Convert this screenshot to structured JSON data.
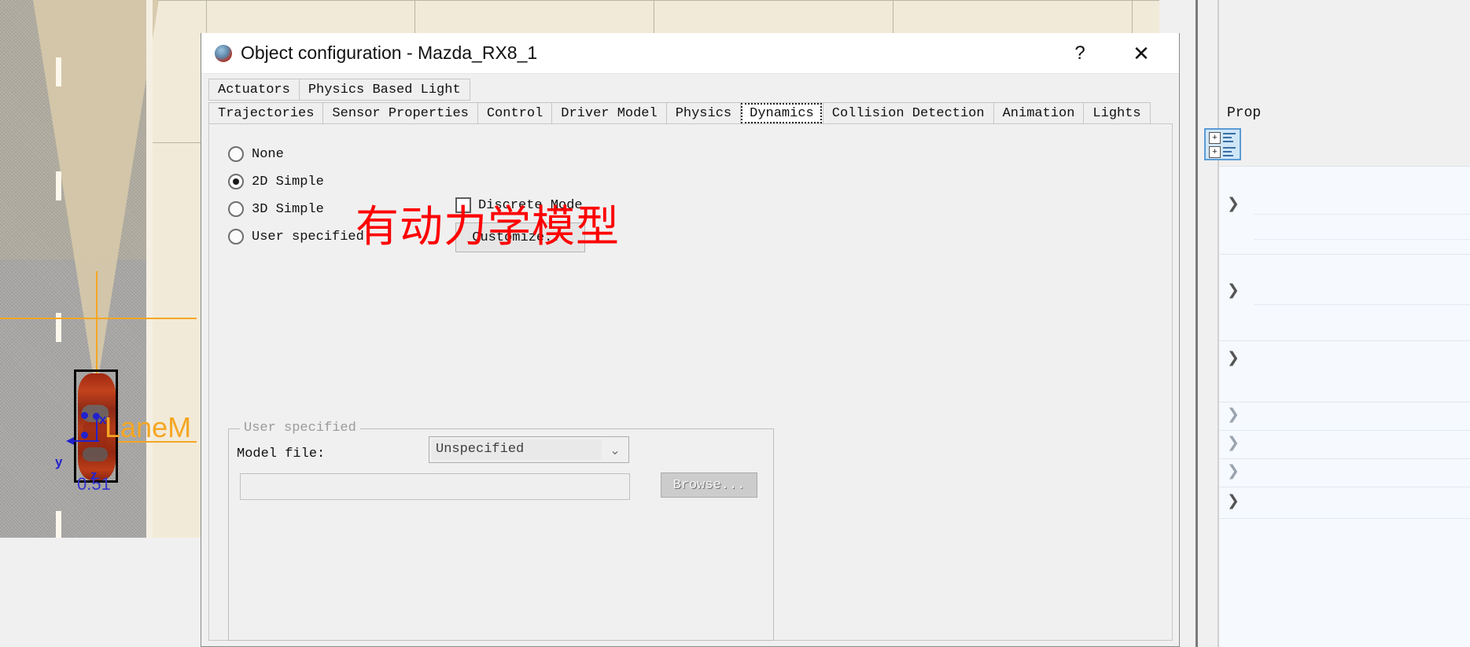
{
  "scene": {
    "lane_marking_label": "LaneM",
    "distance_value": "0.51",
    "axis_labels": {
      "x": "x",
      "y": "y",
      "z": "z"
    }
  },
  "right_panel": {
    "title": "Prop",
    "icon_name": "properties-list-icon",
    "icon_glyph": "+"
  },
  "dialog": {
    "title": "Object configuration - Mazda_RX8_1",
    "app_icon": "app-icon",
    "help_label": "?",
    "close_label": "✕",
    "tabs_top": [
      {
        "label": "Actuators",
        "selected": false
      },
      {
        "label": "Physics Based Light",
        "selected": false
      }
    ],
    "tabs_main": [
      {
        "label": "Trajectories",
        "selected": false
      },
      {
        "label": "Sensor Properties",
        "selected": false
      },
      {
        "label": "Control",
        "selected": false
      },
      {
        "label": "Driver Model",
        "selected": false
      },
      {
        "label": "Physics",
        "selected": false
      },
      {
        "label": "Dynamics",
        "selected": true
      },
      {
        "label": "Collision Detection",
        "selected": false
      },
      {
        "label": "Animation",
        "selected": false
      },
      {
        "label": "Lights",
        "selected": false
      }
    ],
    "dynamics": {
      "radios": [
        {
          "label": "None",
          "checked": false
        },
        {
          "label": "2D Simple",
          "checked": true
        },
        {
          "label": "3D Simple",
          "checked": false
        },
        {
          "label": "User specified",
          "checked": false
        }
      ],
      "discrete_mode": {
        "label": "Discrete Mode",
        "checked": false
      },
      "customize_button": "Customize...",
      "annotation": "有动力学模型",
      "annotation_color": "#ff0000",
      "user_specified_group": {
        "title": "User specified",
        "model_file_label": "Model file:",
        "model_combo_value": "Unspecified",
        "model_combo_arrow": "⌄",
        "model_path_value": "",
        "model_path_placeholder": "",
        "browse_button": "Browse..."
      }
    }
  }
}
